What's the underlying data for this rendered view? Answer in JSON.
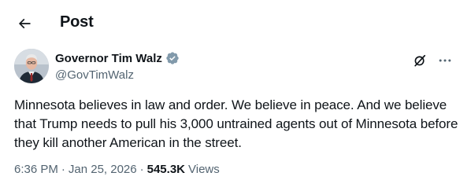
{
  "header": {
    "title": "Post"
  },
  "author": {
    "name": "Governor Tim Walz",
    "handle": "@GovTimWalz",
    "verified": true,
    "badge_color": "#829aab"
  },
  "post": {
    "text": "Minnesota believes in law and order. We believe in peace. And we believe that Trump needs to pull his 3,000 untrained agents out of Minnesota before they kill another American in the street."
  },
  "meta": {
    "time": "6:36 PM",
    "separator": "·",
    "date": "Jan 25, 2026",
    "views_count": "545.3K",
    "views_label": "Views"
  },
  "icons": {
    "back": "arrow-left-icon",
    "grok": "grok-icon",
    "more": "more-icon"
  }
}
